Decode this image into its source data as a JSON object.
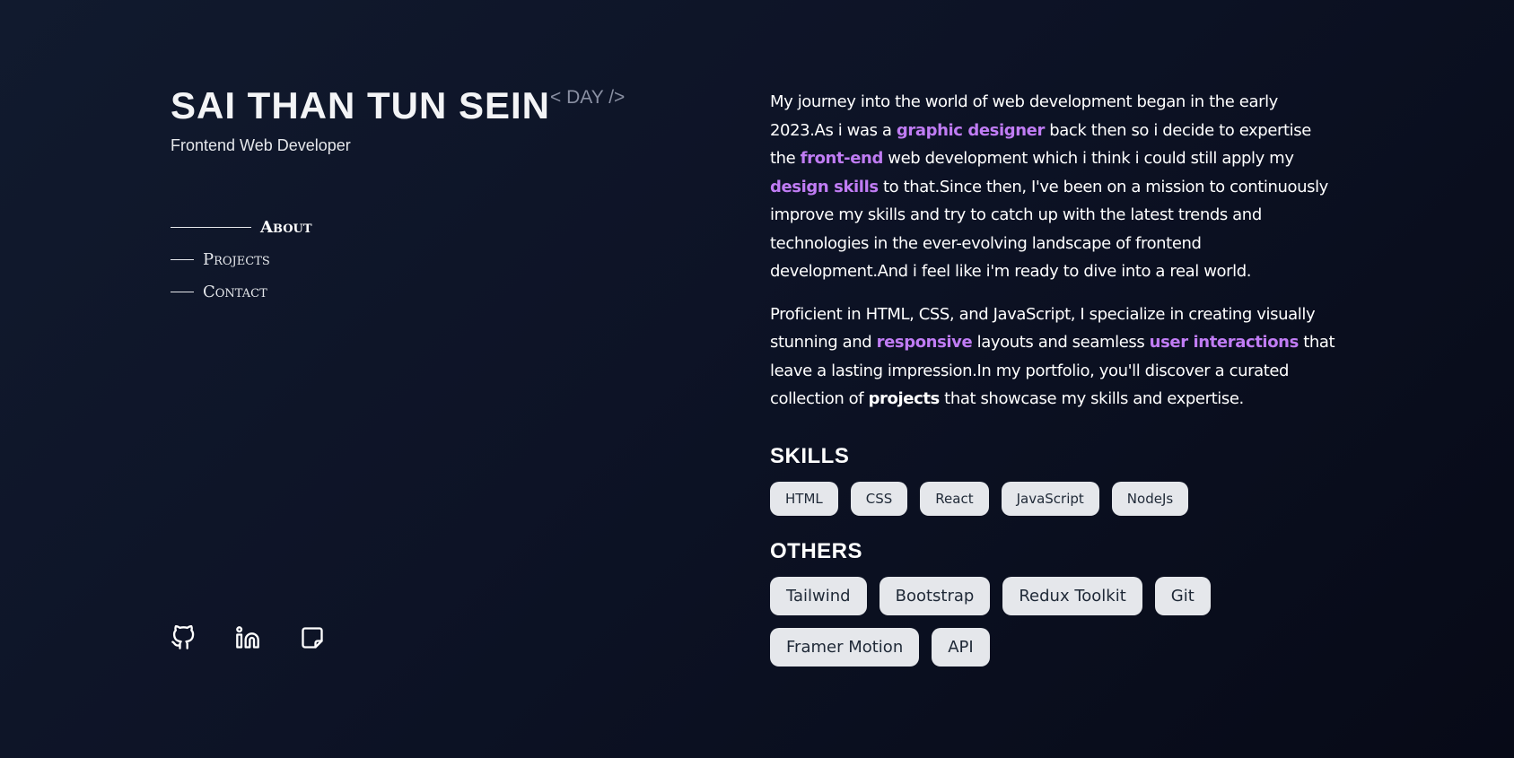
{
  "header": {
    "name": "SAI THAN TUN SEIN",
    "theme_toggle": "< DAY />",
    "role": "Frontend Web Developer"
  },
  "nav": {
    "items": [
      {
        "label": "About",
        "active": true
      },
      {
        "label": "Projects",
        "active": false
      },
      {
        "label": "Contact",
        "active": false
      }
    ]
  },
  "socials": {
    "icons": [
      "github-icon",
      "linkedin-icon",
      "resume-icon"
    ]
  },
  "about": {
    "p1": {
      "t1": "My journey into the world of web development began in the early 2023.As i was a ",
      "h1": "graphic designer",
      "t2": " back then so i decide to expertise the ",
      "h2": "front-end",
      "t3": " web development which i think i could still apply my ",
      "h3": "design skills",
      "t4": " to that.Since then, I've been on a mission to continuously improve my skills and try to catch up with the latest trends and technologies in the ever-evolving landscape of frontend development.And i feel like i'm ready to dive into a real world."
    },
    "p2": {
      "t1": "Proficient in HTML, CSS, and JavaScript, I specialize in creating visually stunning and ",
      "h1": "responsive",
      "t2": " layouts and seamless ",
      "h2": "user interactions",
      "t3": " that leave a lasting impression.In my portfolio, you'll discover a curated collection of ",
      "h3": "projects",
      "t4": " that showcase my skills and expertise."
    }
  },
  "skills": {
    "title": "SKILLS",
    "items": [
      "HTML",
      "CSS",
      "React",
      "JavaScript",
      "NodeJs"
    ]
  },
  "others": {
    "title": "OTHERS",
    "items": [
      "Tailwind",
      "Bootstrap",
      "Redux Toolkit",
      "Git",
      "Framer Motion",
      "API"
    ]
  },
  "colors": {
    "background": "#0d1326",
    "highlight": "#c07cf4",
    "chip_bg": "#e5e7eb",
    "muted": "#8a90a3"
  }
}
